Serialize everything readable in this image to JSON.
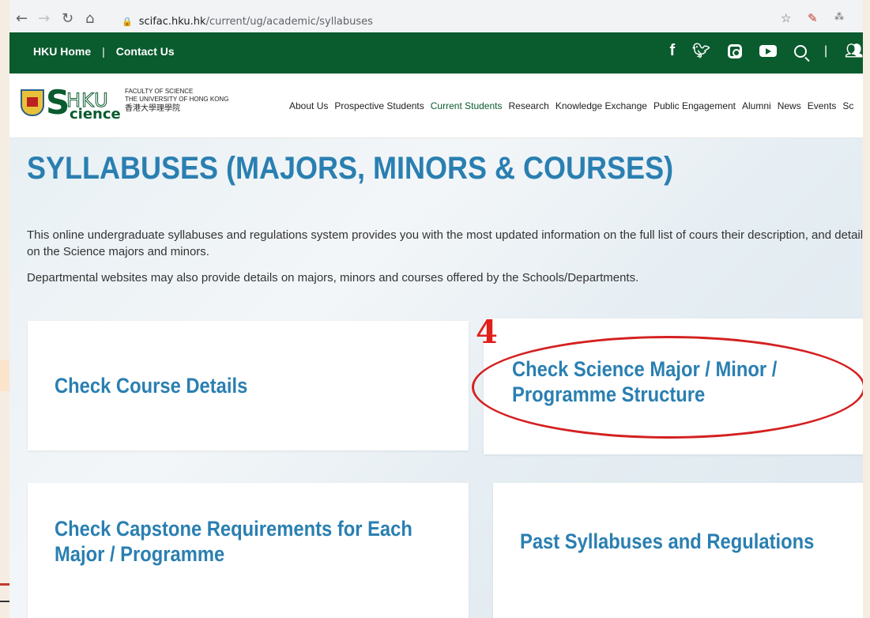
{
  "browser": {
    "url_host": "scifac.hku.hk",
    "url_path": "/current/ug/academic/syllabuses"
  },
  "topbar": {
    "links": [
      "HKU Home",
      "Contact Us"
    ],
    "separator": "|"
  },
  "logo": {
    "lines": [
      "FACULTY OF SCIENCE",
      "THE UNIVERSITY OF HONG KONG",
      "香港大學理學院"
    ]
  },
  "nav": {
    "items": [
      "About Us",
      "Prospective Students",
      "Current Students",
      "Research",
      "Knowledge Exchange",
      "Public Engagement",
      "Alumni",
      "News",
      "Events",
      "Sc"
    ],
    "active": "Current Students"
  },
  "page": {
    "title": "SYLLABUSES (MAJORS, MINORS & COURSES)",
    "intro": "This online undergraduate syllabuses and regulations system provides you with the most updated information on the full list of cours their description, and details on the Science majors and minors.",
    "intro2": "Departmental websites may also provide details on majors, minors and courses offered by the Schools/Departments."
  },
  "cards": [
    {
      "label": "Check Course Details"
    },
    {
      "label": "Check Science Major / Minor / Programme Structure"
    },
    {
      "label": "Check Capstone Requirements for Each Major / Programme"
    },
    {
      "label": "Past Syllabuses and Regulations"
    }
  ],
  "annotation": {
    "number": "4",
    "color": "#d42020"
  },
  "colors": {
    "brand_green": "#0a5b2e",
    "title_blue": "#2a7fb1"
  }
}
